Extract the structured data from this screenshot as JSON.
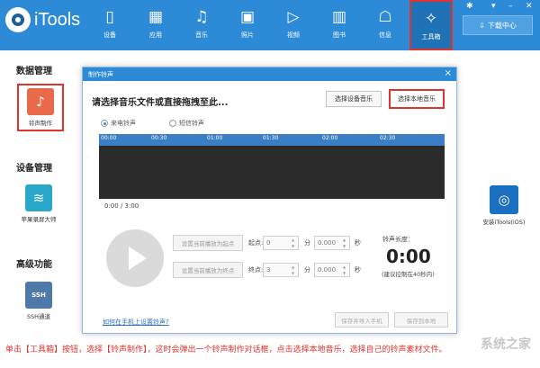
{
  "app": {
    "name": "iTools",
    "download_label": "下载中心"
  },
  "nav": [
    {
      "label": "设备",
      "icon": "phone-icon"
    },
    {
      "label": "应用",
      "icon": "apps-icon"
    },
    {
      "label": "音乐",
      "icon": "music-icon"
    },
    {
      "label": "照片",
      "icon": "photo-icon"
    },
    {
      "label": "视频",
      "icon": "video-icon"
    },
    {
      "label": "图书",
      "icon": "book-icon"
    },
    {
      "label": "信息",
      "icon": "message-icon"
    },
    {
      "label": "工具箱",
      "icon": "toolbox-icon",
      "active": true
    }
  ],
  "sections": {
    "data": "数据管理",
    "device": "设备管理",
    "advanced": "高级功能"
  },
  "tools": {
    "ringtone": "铃声制作",
    "airplay": "苹果录屏大师",
    "ssh": "SSH通道",
    "install_itools": "安装iTools(iOS)"
  },
  "dialog": {
    "title": "制作铃声",
    "header": "请选择音乐文件或直接拖拽至此...",
    "select_device_music": "选择设备音乐",
    "select_local_music": "选择本地音乐",
    "radio_ringtone": "来电铃声",
    "radio_short": "短信铃声",
    "ticks": [
      "00:00",
      "00:30",
      "01:00",
      "01:30",
      "02:00",
      "02:30"
    ],
    "position": "0:00 / 3:00",
    "set_start": "设置当前播放为起点",
    "set_end": "设置当前播放为终点",
    "start_label": "起点:",
    "end_label": "终点:",
    "start_min": "0",
    "start_sec": "0.000",
    "end_min": "3",
    "end_sec": "0.000",
    "unit_min": "分",
    "unit_sec": "秒",
    "length_label": "铃声长度：",
    "length_value": "0:00",
    "length_note": "(建议控制在40秒内)",
    "help_link": "如何在手机上设置铃声?",
    "save_import": "保存并导入手机",
    "save_local": "保存到本地"
  },
  "caption": "单击【工具箱】按钮，选择【铃声制作】，这时会弹出一个铃声制作对话框，点击选择本地音乐，选择自己的铃声素材文件。",
  "watermark": "系统之家",
  "colors": {
    "brand": "#2c8ad6",
    "highlight": "#e0322f"
  }
}
